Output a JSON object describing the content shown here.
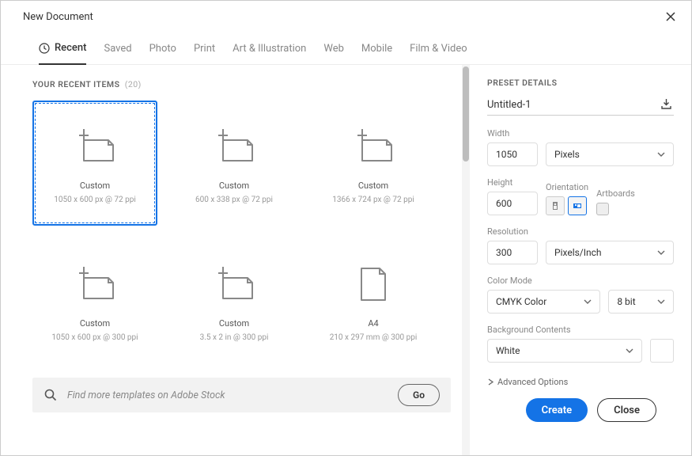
{
  "title": "New Document",
  "tabs": [
    {
      "label": "Recent"
    },
    {
      "label": "Saved"
    },
    {
      "label": "Photo"
    },
    {
      "label": "Print"
    },
    {
      "label": "Art & Illustration"
    },
    {
      "label": "Web"
    },
    {
      "label": "Mobile"
    },
    {
      "label": "Film & Video"
    }
  ],
  "recent": {
    "header": "YOUR RECENT ITEMS",
    "count": "(20)",
    "items": [
      {
        "label": "Custom",
        "dims": "1050 x 600 px @ 72 ppi",
        "kind": "page"
      },
      {
        "label": "Custom",
        "dims": "600 x 338 px @ 72 ppi",
        "kind": "page"
      },
      {
        "label": "Custom",
        "dims": "1366 x 724 px @ 72 ppi",
        "kind": "page"
      },
      {
        "label": "Custom",
        "dims": "1050 x 600 px @ 300 ppi",
        "kind": "page"
      },
      {
        "label": "Custom",
        "dims": "3.5 x 2 in @ 300 ppi",
        "kind": "page"
      },
      {
        "label": "A4",
        "dims": "210 x 297 mm @ 300 ppi",
        "kind": "sheet"
      }
    ]
  },
  "search": {
    "placeholder": "Find more templates on Adobe Stock",
    "go": "Go"
  },
  "preset": {
    "header": "PRESET DETAILS",
    "name": "Untitled-1",
    "widthLabel": "Width",
    "width": "1050",
    "unit": "Pixels",
    "heightLabel": "Height",
    "height": "600",
    "orientationLabel": "Orientation",
    "artboardsLabel": "Artboards",
    "resolutionLabel": "Resolution",
    "resolution": "300",
    "resUnit": "Pixels/Inch",
    "colorModeLabel": "Color Mode",
    "colorMode": "CMYK Color",
    "bitDepth": "8 bit",
    "bgLabel": "Background Contents",
    "bg": "White",
    "advanced": "Advanced Options"
  },
  "buttons": {
    "create": "Create",
    "close": "Close"
  }
}
